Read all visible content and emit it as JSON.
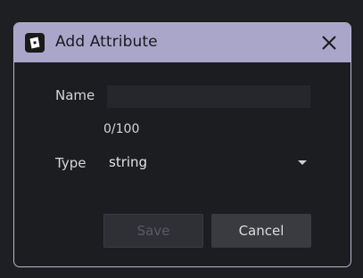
{
  "dialog": {
    "title": "Add Attribute",
    "name_label": "Name",
    "name_value": "",
    "counter": "0/100",
    "type_label": "Type",
    "type_value": "string",
    "save_label": "Save",
    "cancel_label": "Cancel",
    "icons": {
      "app": "roblox-studio-icon",
      "close": "close-icon",
      "dropdown": "chevron-down-icon"
    },
    "colors": {
      "titlebar": "#a9a6c9",
      "background": "#1c1d21",
      "input": "#26272c",
      "button_disabled": "#2f3036",
      "button": "#3a3b40"
    }
  }
}
